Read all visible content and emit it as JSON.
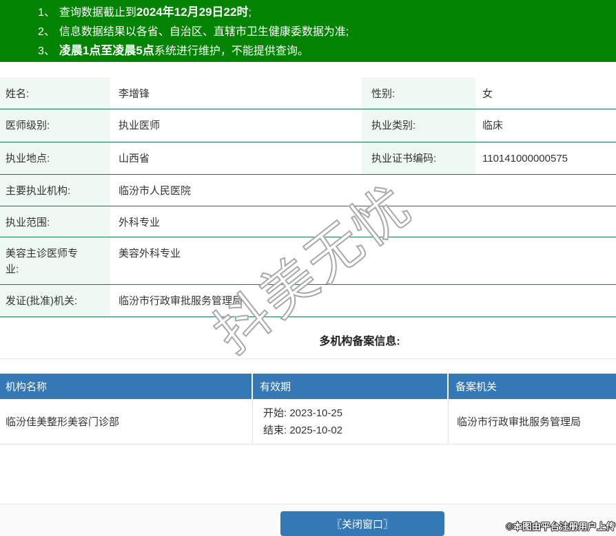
{
  "banner": {
    "bg_color": "#028402",
    "items": [
      {
        "num": "1、",
        "pre": "查询数据截止到",
        "bold": "2024年12月29日22时",
        "post": ";"
      },
      {
        "num": "2、",
        "pre": "信息数据结果以各省、自治区、直辖市卫生健康委数据为准;",
        "bold": "",
        "post": ""
      },
      {
        "num": "3、",
        "pre": "",
        "bold": "凌晨1点至凌晨5点",
        "post": "系统进行维护，不能提供查询。"
      }
    ]
  },
  "info": {
    "label_bg": "#eef9f3",
    "divider_color": "#177a4a",
    "rows": [
      {
        "label1": "姓名:",
        "value1": "李增锋",
        "label2": "性别:",
        "value2": "女"
      },
      {
        "label1": "医师级别:",
        "value1": "执业医师",
        "label2": "执业类别:",
        "value2": "临床"
      },
      {
        "label1": "执业地点:",
        "value1": "山西省",
        "label2": "执业证书编码:",
        "value2": "110141000000575"
      },
      {
        "label": "主要执业机构:",
        "value": "临汾市人民医院"
      },
      {
        "label": "执业范围:",
        "value": "外科专业"
      },
      {
        "label": "美容主诊医师专业:",
        "value": "美容外科专业"
      },
      {
        "label": "发证(批准)机关:",
        "value": "临汾市行政审批服务管理局"
      }
    ]
  },
  "filing": {
    "heading": "多机构备案信息:",
    "header_bg": "#3478b5",
    "headers": [
      "机构名称",
      "有效期",
      "备案机关"
    ],
    "rows": [
      {
        "org": "临汾佳美整形美容门诊部",
        "start_label": "开始:",
        "start_date": "2023-10-25",
        "end_label": "结束:",
        "end_date": "2025-10-02",
        "authority": "临汾市行政审批服务管理局"
      }
    ]
  },
  "footer": {
    "close_button": "〖关闭窗口〗",
    "button_color": "#3478b5",
    "copyright": "©本图由平台注册用户上传"
  },
  "watermark": {
    "text": "抖美无忧"
  }
}
